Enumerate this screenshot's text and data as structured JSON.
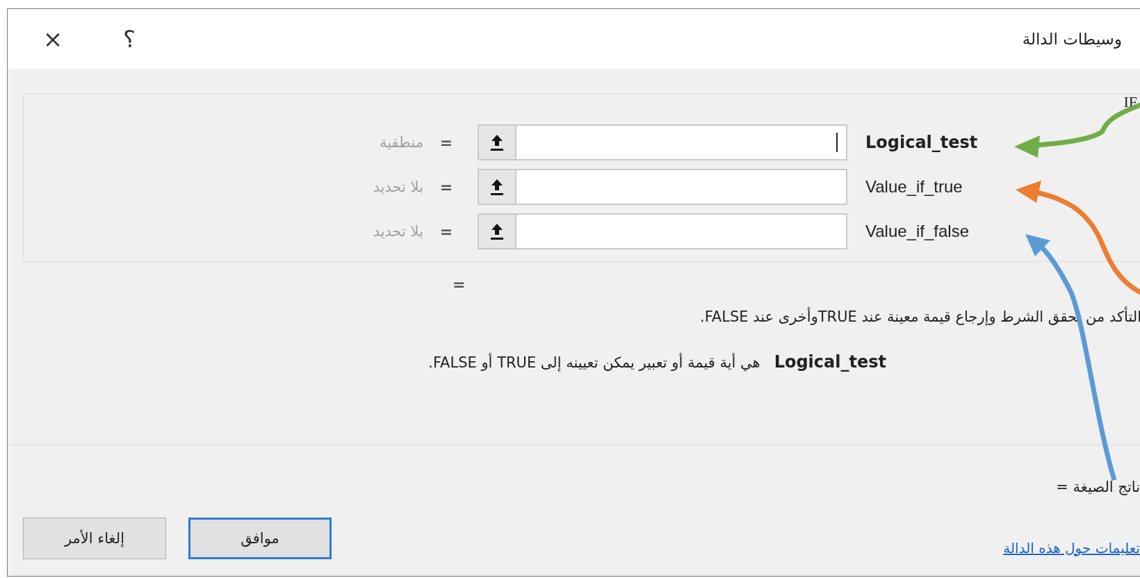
{
  "window": {
    "title": "وسيطات الدالة",
    "help": "؟",
    "close": "×"
  },
  "function_name": "IF",
  "arguments": [
    {
      "label": "Logical_test",
      "focused": true,
      "result": "منطقية"
    },
    {
      "label": "Value_if_true",
      "focused": false,
      "result": "بلا تحديد"
    },
    {
      "label": "Value_if_false",
      "focused": false,
      "result": "بلا تحديد"
    }
  ],
  "equals": "=",
  "result_equals": "=",
  "description": "التأكد من تحقق الشرط وإرجاع قيمة معينة عند TRUEوأخرى عند FALSE.",
  "argument_help": {
    "name": "Logical_test",
    "text": "هي أية قيمة أو تعبير يمكن تعيينه إلى TRUE أو FALSE."
  },
  "formula_result": "ناتج الصيغة =",
  "help_link": "تعليمات حول هذه الدالة",
  "buttons": [
    {
      "label": "موافق",
      "default": true
    },
    {
      "label": "إلغاء الأمر",
      "default": false
    }
  ],
  "annotations": [
    {
      "color": "#70ad47"
    },
    {
      "color": "#ed7d31"
    },
    {
      "color": "#5b9bd5"
    }
  ]
}
